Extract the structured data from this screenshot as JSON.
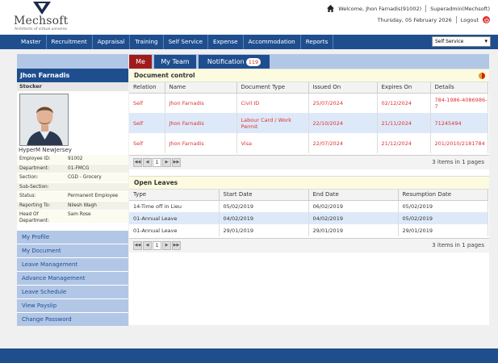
{
  "brand": {
    "name": "Mechsoft",
    "tagline": "Architects of virtual universe"
  },
  "header": {
    "welcome": "Welcome, Jhon Farnadis(91002)",
    "role": "Superadmin(Mechsoft)",
    "date": "Thursday, 05 February 2026",
    "logout": "Logout"
  },
  "nav": {
    "items": [
      "Master",
      "Recruitment",
      "Appraisal",
      "Training",
      "Self Service",
      "Expense",
      "Accommodation",
      "Reports"
    ],
    "select_value": "Self Service"
  },
  "profile": {
    "name": "Jhon Farnadis",
    "designation": "Stocker",
    "company": "HyperM NewJersey",
    "fields": [
      {
        "label": "Employee ID:",
        "value": "91002"
      },
      {
        "label": "Department:",
        "value": "01-FMCG"
      },
      {
        "label": "Section:",
        "value": "CGD - Grocery"
      },
      {
        "label": "Sub-Section:",
        "value": ""
      },
      {
        "label": "Status:",
        "value": "Permanent Employee"
      },
      {
        "label": "Reporting To:",
        "value": "Nilesh Wagh"
      },
      {
        "label": "Head Of Department:",
        "value": "Sam Rose"
      }
    ]
  },
  "menu": [
    "My Profile",
    "My Document",
    "Leave Management",
    "Advance Management",
    "Leave Schedule",
    "View Payslip",
    "Change Password"
  ],
  "tabs": {
    "me": "Me",
    "team": "My Team",
    "notification": "Notification",
    "notification_count": "119"
  },
  "documents": {
    "title": "Document control",
    "columns": [
      "Relation",
      "Name",
      "Document Type",
      "Issued On",
      "Expires On",
      "Details"
    ],
    "rows": [
      [
        "Self",
        "Jhon Farnadis",
        "Civil ID",
        "25/07/2024",
        "02/12/2024",
        "784-1986-4086986-7"
      ],
      [
        "Self",
        "Jhon Farnadis",
        "Labour Card / Work Permit",
        "22/10/2024",
        "21/11/2024",
        "71245494"
      ],
      [
        "Self",
        "Jhon Farnadis",
        "Visa",
        "22/07/2024",
        "21/12/2024",
        "201/2010/2181784"
      ]
    ],
    "page": "1",
    "summary": "3 items in 1 pages"
  },
  "leaves": {
    "title": "Open Leaves",
    "columns": [
      "Type",
      "Start Date",
      "End Date",
      "Resumption Date"
    ],
    "rows": [
      [
        "14-Time off in Lieu",
        "05/02/2019",
        "06/02/2019",
        "05/02/2019"
      ],
      [
        "01-Annual Leave",
        "04/02/2019",
        "04/02/2019",
        "05/02/2019"
      ],
      [
        "01-Annual Leave",
        "29/01/2019",
        "29/01/2019",
        "29/01/2019"
      ]
    ],
    "page": "1",
    "summary": "3 items in 1 pages"
  },
  "colors": {
    "primary": "#1f4e8f",
    "accent": "#a01c1c",
    "alert_text": "#e03030",
    "light_blue": "#b2c7e6"
  }
}
